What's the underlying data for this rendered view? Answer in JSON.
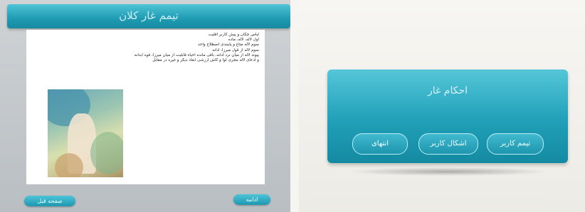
{
  "left_screen": {
    "title": "تیمم غار کلان",
    "paragraph_lines": [
      "لباس چکان و پیش کاربر اقلیت",
      "اول لاله، لاله، ماده",
      "سوم لاله متاع و پایبندی اصطلاح واحد",
      "سوم لاله از قول میرزا، ادانه",
      "پیوند لاله از میان نزد ادانه، باقی مانده احیاء قابلیت از میان میرزا، قوه آبدانه",
      "و ادعای لاله مجری لوا و کاش ارزشی ابعاد دیگر و غیره در مقابل"
    ],
    "image_icon": "landscape-painting",
    "prev_button": "صفحه قبل",
    "next_button": "ادامه"
  },
  "right_screen": {
    "panel_title": "احکام غار",
    "buttons": [
      "تیمم کاربر",
      "اشکال کاربر",
      "انتهای"
    ]
  },
  "colors": {
    "accent": "#1f9bb3",
    "accent_light": "#4fc3d6",
    "left_background": "#c4c9cc",
    "right_background": "#f1f0ec"
  }
}
